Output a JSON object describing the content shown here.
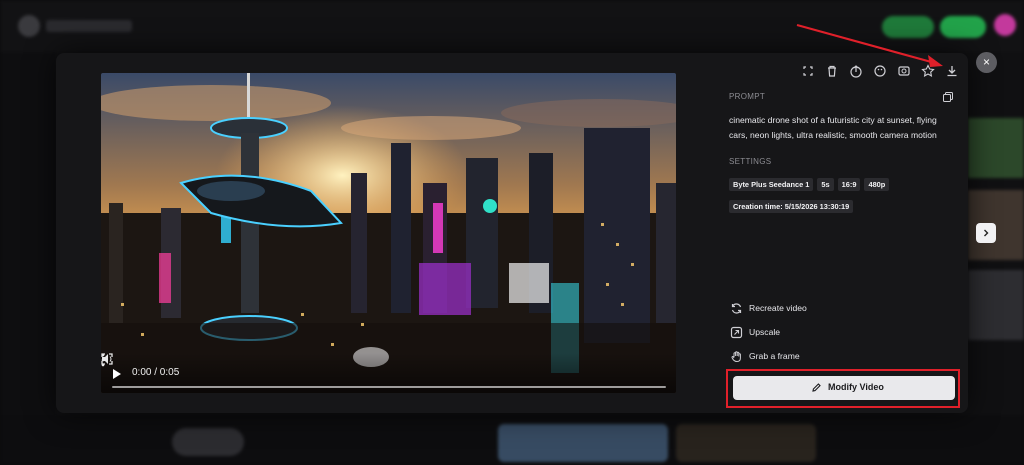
{
  "video": {
    "time": "0:00 / 0:05",
    "progress": 0.0
  },
  "toolbar": {
    "icons": [
      "fullscreen-icon",
      "trash-icon",
      "share-icon",
      "palette-icon",
      "media-icon",
      "star-icon",
      "download-icon"
    ]
  },
  "prompt": {
    "label": "PROMPT",
    "text": "cinematic drone shot of a futuristic city at sunset, flying cars, neon lights, ultra realistic, smooth camera motion"
  },
  "settings": {
    "label": "SETTINGS",
    "chips": [
      "Byte Plus Seedance 1",
      "5s",
      "16:9",
      "480p"
    ],
    "creation": "Creation time: 5/15/2026 13:30:19"
  },
  "actions": {
    "recreate": "Recreate video",
    "upscale": "Upscale",
    "grab": "Grab a frame"
  },
  "modify_button": "Modify Video",
  "close_symbol": "×",
  "colors": {
    "highlight": "#e0202a",
    "annotation_arrow": "#e0202a",
    "panel_bg": "#161618",
    "button_bg": "#e9e9ec"
  }
}
